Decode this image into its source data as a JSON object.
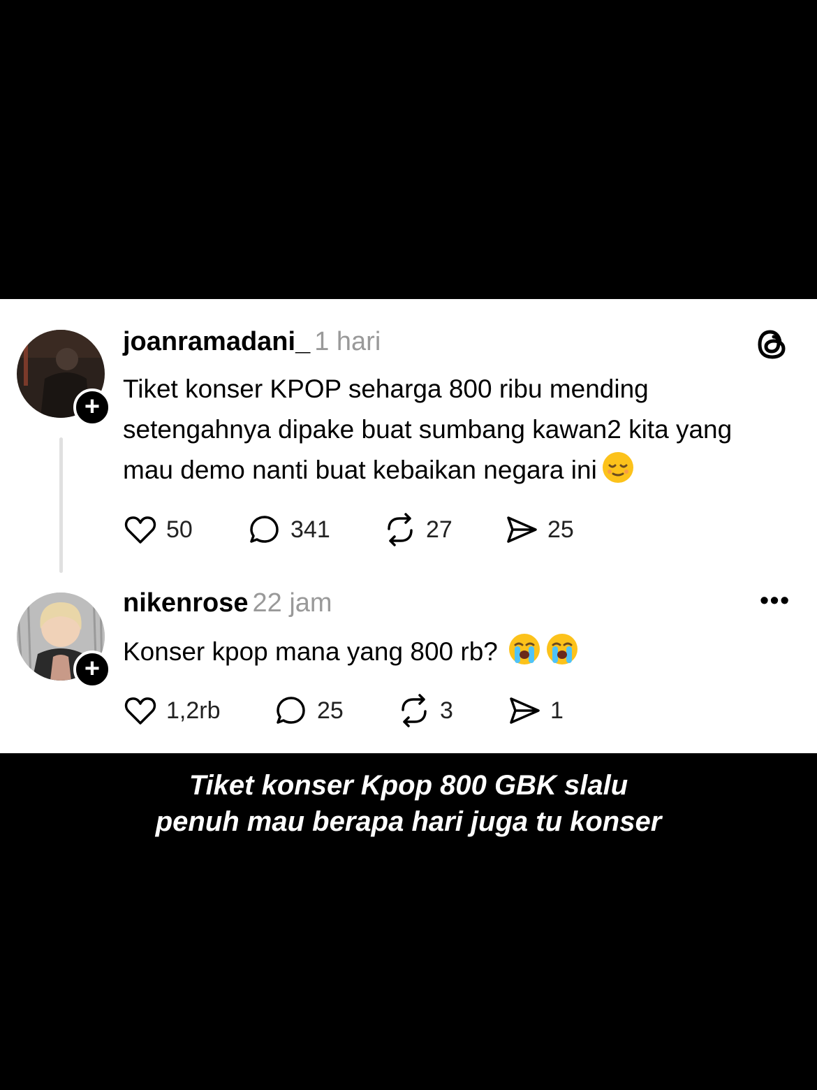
{
  "posts": [
    {
      "username": "joanramadani_",
      "time": "1 hari",
      "text": "Tiket konser KPOP seharga 800 ribu mending setengahnya dipake buat sumbang kawan2 kita yang mau demo nanti buat kebaikan negara ini",
      "emoji": "relieved-face",
      "likes": "50",
      "replies": "341",
      "reposts": "27",
      "shares": "25"
    },
    {
      "username": "nikenrose",
      "time": "22 jam",
      "text": "Konser kpop mana yang 800 rb?",
      "emoji": "loudly-crying-face",
      "likes": "1,2rb",
      "replies": "25",
      "reposts": "3",
      "shares": "1"
    }
  ],
  "caption": {
    "line1": "Tiket konser Kpop 800 GBK slalu",
    "line2": "penuh mau berapa hari juga tu konser"
  },
  "colors": {
    "background": "#000000",
    "card": "#ffffff",
    "muted": "#999999"
  },
  "icons": [
    "threads-logo-icon",
    "more-icon",
    "heart-icon",
    "comment-icon",
    "repost-icon",
    "share-icon"
  ]
}
